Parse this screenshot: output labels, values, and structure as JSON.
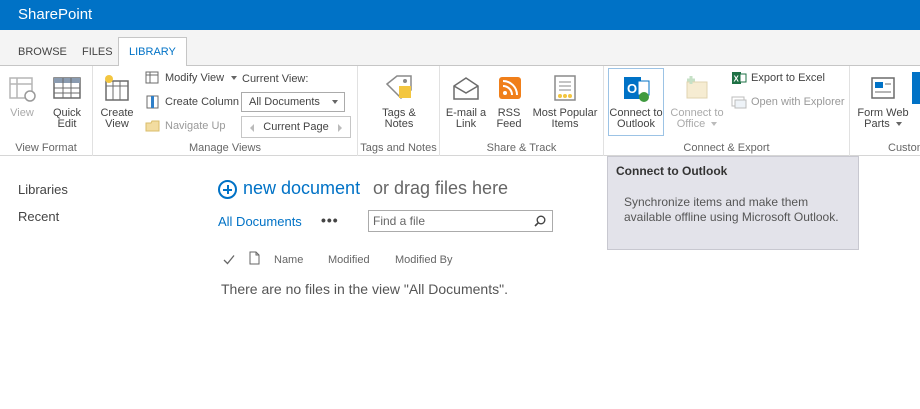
{
  "app": {
    "title": "SharePoint"
  },
  "tabs": [
    {
      "label": "BROWSE"
    },
    {
      "label": "FILES"
    },
    {
      "label": "LIBRARY",
      "active": true
    }
  ],
  "ribbon": {
    "view_format": {
      "label": "View Format",
      "view": "View",
      "quick_edit": [
        "Quick",
        "Edit"
      ]
    },
    "manage_views": {
      "label": "Manage Views",
      "create_view": [
        "Create",
        "View"
      ],
      "modify_view": "Modify View",
      "create_column": "Create Column",
      "navigate_up": "Navigate Up",
      "current_view_label": "Current View:",
      "current_view_value": "All Documents",
      "current_page": "Current Page"
    },
    "tags_notes": {
      "label": "Tags and Notes",
      "tags_notes": [
        "Tags &",
        "Notes"
      ]
    },
    "share_track": {
      "label": "Share & Track",
      "email_link": [
        "E-mail a",
        "Link"
      ],
      "rss_feed": [
        "RSS",
        "Feed"
      ],
      "most_popular": [
        "Most Popular",
        "Items"
      ]
    },
    "connect_export": {
      "label": "Connect & Export",
      "connect_outlook": [
        "Connect to",
        "Outlook"
      ],
      "connect_office": [
        "Connect to",
        "Office"
      ],
      "export_excel": "Export to Excel",
      "open_explorer": "Open with Explorer"
    },
    "customize": {
      "label": "Custom",
      "form_web_parts": [
        "Form Web",
        "Parts"
      ]
    }
  },
  "tooltip": {
    "title": "Connect to Outlook",
    "body": "Synchronize items and make them available offline using Microsoft Outlook."
  },
  "leftnav": {
    "items": [
      {
        "label": "Libraries"
      },
      {
        "label": "Recent"
      }
    ]
  },
  "main": {
    "new_doc_link": "new document",
    "new_doc_rest": "or drag files here",
    "view_link": "All Documents",
    "more": "•••",
    "search_placeholder": "Find a file",
    "columns": [
      "Name",
      "Modified",
      "Modified By"
    ],
    "empty_message": "There are no files in the view \"All Documents\"."
  },
  "colors": {
    "accent": "#0072c6"
  }
}
